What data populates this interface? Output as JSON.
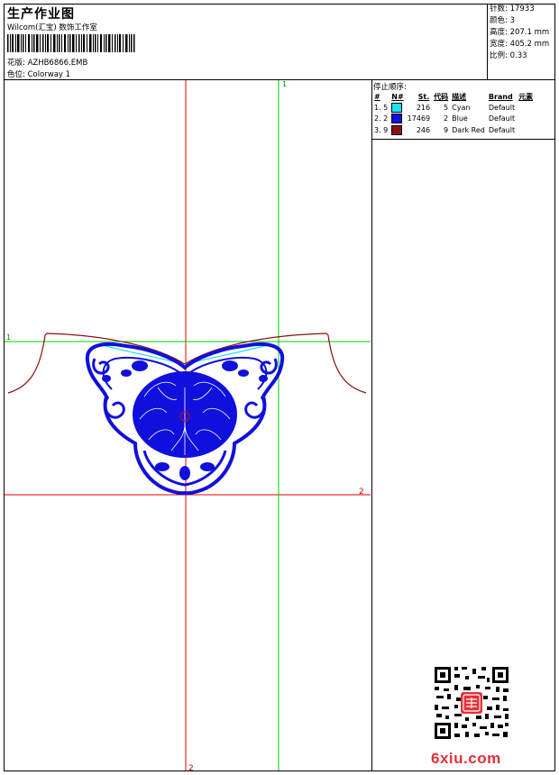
{
  "header": {
    "title": "生产作业图",
    "studio": "Wilcom(汇宝) 数饰工作室",
    "design_label": "花版: AZHB6866.EMB",
    "colorway_label": "色位: Colorway 1"
  },
  "stats": [
    {
      "label": "针数:",
      "value": "17933"
    },
    {
      "label": "颜色:",
      "value": "3"
    },
    {
      "label": "高度:",
      "value": "207.1 mm"
    },
    {
      "label": "宽度:",
      "value": "405.2 mm"
    },
    {
      "label": "比例:",
      "value": "0.33"
    }
  ],
  "stop_sequence": {
    "title": "停止顺序:",
    "columns": [
      "#",
      "N#",
      "St.",
      "代码",
      "描述",
      "Brand",
      "元素"
    ],
    "rows": [
      {
        "seq": "1. 5",
        "n": "",
        "color": "#1ee0ee",
        "st": "216",
        "code": "5",
        "desc": "Cyan",
        "brand": "Default"
      },
      {
        "seq": "2. 2",
        "n": "",
        "color": "#1010dd",
        "st": "17469",
        "code": "2",
        "desc": "Blue",
        "brand": "Default"
      },
      {
        "seq": "3. 9",
        "n": "",
        "color": "#8b1010",
        "st": "246",
        "code": "9",
        "desc": "Dark Red",
        "brand": "Default"
      }
    ]
  },
  "canvas": {
    "guide_labels": {
      "green_v": "1",
      "green_h": "1",
      "red_h": "2",
      "red_v": "2"
    },
    "colors": {
      "red_guide": "#e00000",
      "green_guide": "#00cc00",
      "outline": "#8b1010",
      "fill": "#1010dd",
      "accent": "#1ee0ee"
    }
  },
  "watermark": "6xiu.com"
}
